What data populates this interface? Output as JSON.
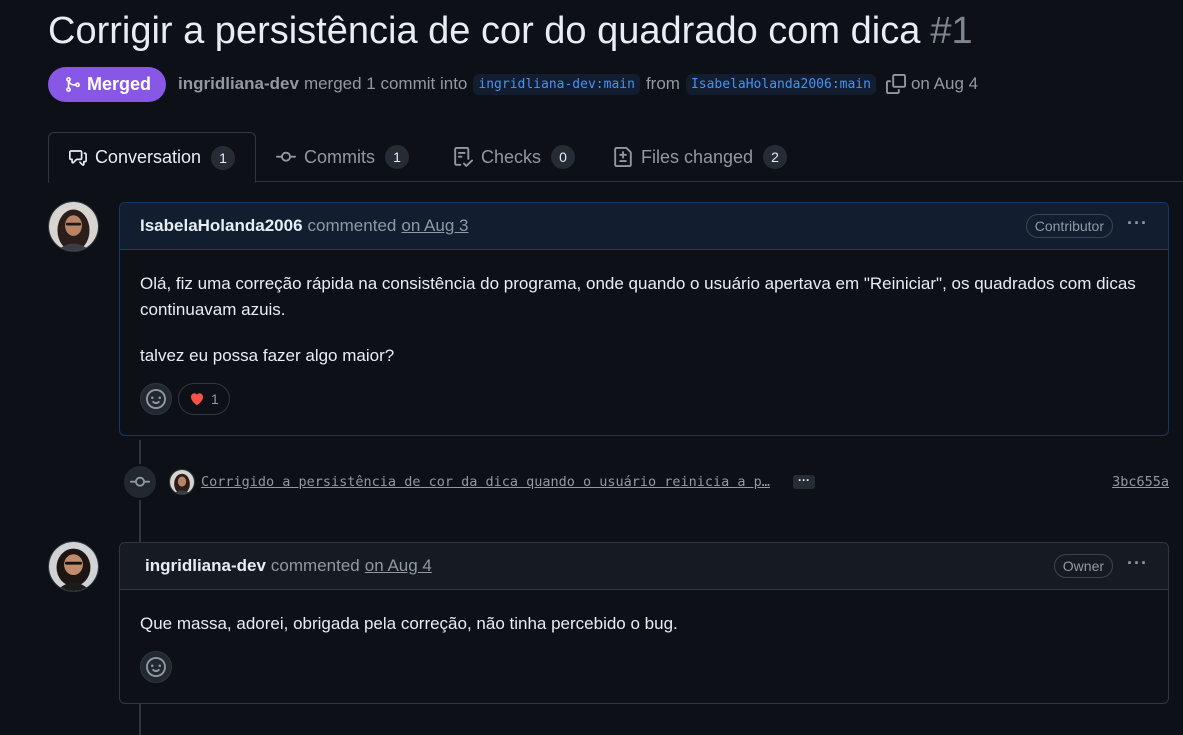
{
  "pr": {
    "title": "Corrigir a persistência de cor do quadrado com dica",
    "number": "#1",
    "state_label": "Merged",
    "author": "ingridliana-dev",
    "merged_text": "merged 1 commit into",
    "base_branch": "ingridliana-dev:main",
    "from_text": "from",
    "head_branch": "IsabelaHolanda2006:main",
    "date_text": "on Aug 4"
  },
  "tabs": [
    {
      "label": "Conversation",
      "count": "1",
      "icon": "comment-discussion-icon"
    },
    {
      "label": "Commits",
      "count": "1",
      "icon": "git-commit-icon"
    },
    {
      "label": "Checks",
      "count": "0",
      "icon": "checklist-icon"
    },
    {
      "label": "Files changed",
      "count": "2",
      "icon": "file-diff-icon"
    }
  ],
  "comments": [
    {
      "author": "IsabelaHolanda2006",
      "verb": "commented",
      "date": "on Aug 3",
      "role": "Contributor",
      "menu": "···",
      "paragraphs": [
        "Olá, fiz uma correção rápida na consistência do programa, onde quando o usuário apertava em \"Reiniciar\", os quadrados com dicas continuavam azuis.",
        "talvez eu possa fazer algo maior?"
      ],
      "reaction_count": "1"
    },
    {
      "author": "ingridliana-dev",
      "verb": "commented",
      "date": "on Aug 4",
      "role": "Owner",
      "menu": "···",
      "paragraphs": [
        "Que massa, adorei, obrigada pela correção, não tinha percebido o bug."
      ]
    }
  ],
  "commit": {
    "message": "Corrigido a persistência de cor da dica quando o usuário reinicia a p…",
    "ellipsis": "···",
    "sha": "3bc655a"
  },
  "colors": {
    "merged": "#8957e5",
    "link": "#4493f8",
    "heart": "#f85149"
  }
}
